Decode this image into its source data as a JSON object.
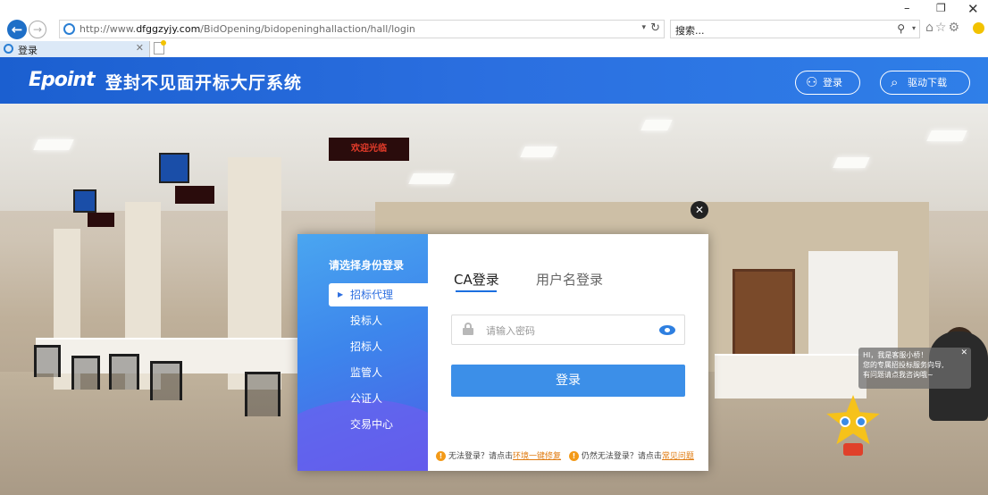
{
  "browser": {
    "url_prefix": "http://www.",
    "url_domain": "dfggzyjy.com",
    "url_path": "/BidOpening/bidopeninghallaction/hall/login",
    "search_placeholder": "搜索...",
    "tab_title": "登录",
    "minimize": "–",
    "maximize": "❐",
    "close": "✕",
    "toolbar_icons": "⌂☆⚙"
  },
  "header": {
    "logo": "Epoint",
    "title": "登封不见面开标大厅系统",
    "login_label": "登录",
    "driver_label": "驱动下载"
  },
  "dialog": {
    "role_title": "请选择身份登录",
    "roles": [
      "招标代理",
      "投标人",
      "招标人",
      "监管人",
      "公证人",
      "交易中心"
    ],
    "tab_ca": "CA登录",
    "tab_user": "用户名登录",
    "password_placeholder": "请输入密码",
    "login_button": "登录",
    "help_text_1": "无法登录？请点击",
    "help_link_1": "环境一键修复",
    "help_text_2": "仍然无法登录？请点击",
    "help_link_2": "常见问题"
  },
  "chat": {
    "line1": "HI，我是客服小桥！",
    "line2": "您的专属招投标服务向导,",
    "line3": "有问题请点我咨询哦~"
  },
  "scene": {
    "sign_welcome": "欢迎光临"
  },
  "colors": {
    "header_blue": "#2b6fe0",
    "button_blue": "#3c8fe8",
    "warning_orange": "#f39a18"
  }
}
